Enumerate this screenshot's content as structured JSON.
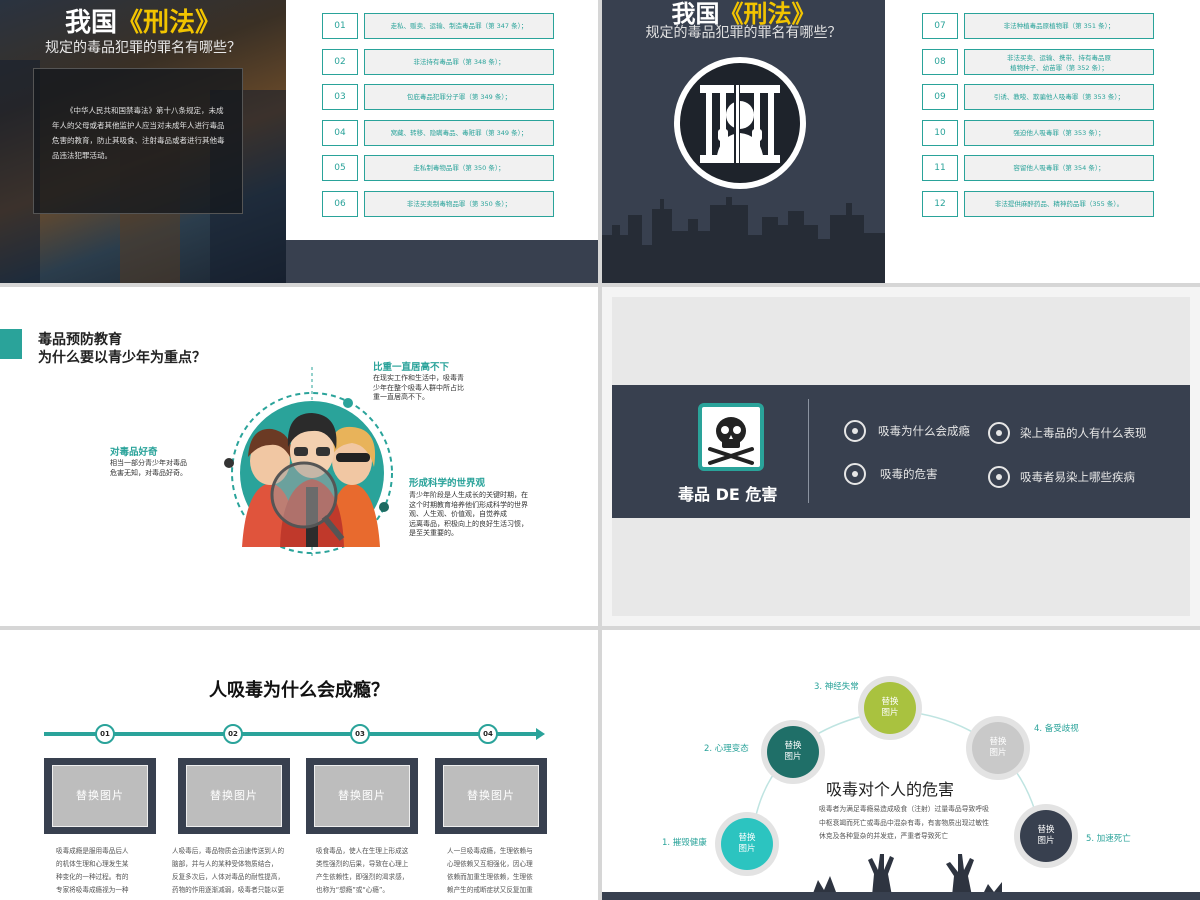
{
  "slide1": {
    "title_main": "我国",
    "title_highlight": "《刑法》",
    "subtitle": "规定的毒品犯罪的罪名有哪些？",
    "box_text": "《中华人民共和国禁毒法》第十八条规定，未成年人的父母或者其他监护人应当对未成年人进行毒品危害的教育，防止其吸食、注射毒品或者进行其他毒品违法犯罪活动。",
    "crimes": [
      {
        "num": "01",
        "text": "走私、贩卖、运输、制造毒品罪（第 347 条）；"
      },
      {
        "num": "02",
        "text": "非法持有毒品罪（第 348 条）；"
      },
      {
        "num": "03",
        "text": "包庇毒品犯罪分子罪（第 349 条）；"
      },
      {
        "num": "04",
        "text": "窝藏、转移、隐瞒毒品、毒赃罪（第 349 条）；"
      },
      {
        "num": "05",
        "text": "走私制毒物品罪（第 350 条）；"
      },
      {
        "num": "06",
        "text": "非法买卖制毒物品罪（第 350 条）；"
      }
    ]
  },
  "slide2": {
    "title_main": "我国",
    "title_highlight": "《刑法》",
    "subtitle": "规定的毒品犯罪的罪名有哪些？",
    "crimes": [
      {
        "num": "07",
        "text": "非法种植毒品原植物罪（第 351 条）；"
      },
      {
        "num": "08",
        "line1": "非法买卖、运输、携带、持有毒品原",
        "line2": "植物种子、幼苗罪（第 352 条）；"
      },
      {
        "num": "09",
        "text": "引诱、教唆、欺骗他人吸毒罪（第 353 条）；"
      },
      {
        "num": "10",
        "text": "强迫他人吸毒罪（第 353 条）；"
      },
      {
        "num": "11",
        "text": "容留他人吸毒罪（第 354 条）；"
      },
      {
        "num": "12",
        "text": "非法提供麻醉药品、精神药品罪（355 条）。"
      }
    ]
  },
  "slide3": {
    "heading1": "毒品预防教育",
    "heading2": "为什么要以青少年为重点？",
    "points": [
      {
        "title": "比重一直居高不下",
        "text": [
          "在现实工作和生活中，吸毒青",
          "少年在整个吸毒人群中所占比",
          "重一直居高不下。"
        ]
      },
      {
        "title": "对毒品好奇",
        "text": [
          "相当一部分青少年对毒品",
          "危害无知，对毒品好奇。"
        ]
      },
      {
        "title": "形成科学的世界观",
        "text": [
          "青少年阶段是人生成长的关键时期，在",
          "这个时期教育培养他们形成科学的世界",
          "观、人生观、价值观，自觉养成",
          "远离毒品，积极向上的良好生活习惯，",
          "是至关重要的。"
        ]
      }
    ]
  },
  "slide4": {
    "title": "毒品 DE 危害",
    "items": [
      "吸毒为什么会成瘾",
      "染上毒品的人有什么表现",
      "吸毒的危害",
      "吸毒者易染上哪些疾病"
    ]
  },
  "slide5": {
    "title": "人吸毒为什么会成瘾？",
    "steps": [
      {
        "num": "01",
        "placeholder": "替换图片",
        "text": [
          "吸毒成瘾是服用毒品后人",
          "的机体生理和心理发生某",
          "种变化的一种过程。有的",
          "专家将吸毒成瘾视为一种"
        ]
      },
      {
        "num": "02",
        "placeholder": "替换图片",
        "text": [
          "人吸毒后，毒品物质会迅速传送到人的",
          "脑部，并与人的某种受体物质结合，",
          "反复多次后，人体对毒品的耐性提高，",
          "药物的作用逐渐减弱，吸毒者只能以更"
        ]
      },
      {
        "num": "03",
        "placeholder": "替换图片",
        "text": [
          "吸食毒品，使人在生理上形成这",
          "类性强烈的后果，导致在心理上",
          "产生依赖性，即强烈的渴求感，",
          "也称为“想瘾”或“心瘾”。"
        ]
      },
      {
        "num": "04",
        "placeholder": "替换图片",
        "text": [
          "人一旦吸毒成瘾，生理依赖与",
          "心理依赖又互相强化，因心理",
          "依赖而加重生理依赖，生理依",
          "赖产生的戒断症状又反复加重"
        ]
      }
    ]
  },
  "slide6": {
    "title": "吸毒对个人的危害",
    "body": "吸毒者为满足毒瘾易造成吸食（注射）过量毒品导致呼吸中枢衰竭而死亡或毒品中混杂有毒，有害物质出现过敏性休克及各种复杂的并发症，严重者导致死亡",
    "circles": [
      {
        "label": "1. 摧毁健康",
        "photo": "替换\n图片",
        "color": "#2cc4c0"
      },
      {
        "label": "2. 心理变态",
        "photo": "替换\n图片",
        "color": "#1f6f68"
      },
      {
        "label": "3. 神经失常",
        "photo": "替换\n图片",
        "color": "#a9c23f"
      },
      {
        "label": "4. 备受歧视",
        "photo": "替换\n图片",
        "color": "#c9c9c9"
      },
      {
        "label": "5. 加速死亡",
        "photo": "替换\n图片",
        "color": "#38404f"
      }
    ]
  },
  "colors": {
    "accent": "#2aa39a",
    "dark": "#38404f",
    "highlight": "#f2c400"
  }
}
